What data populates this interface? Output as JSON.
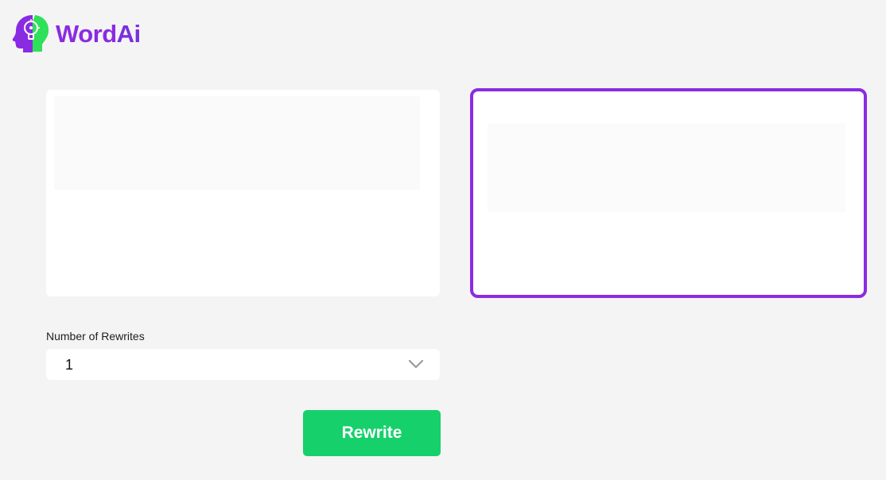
{
  "brand": {
    "name_word": "Word",
    "name_ai": "Ai",
    "logo_icon": "head-lightbulb-icon",
    "purple": "#8a2be2",
    "green": "#16d06b"
  },
  "editor": {
    "input_value": "",
    "output_value": ""
  },
  "rewrites": {
    "label": "Number of Rewrites",
    "selected": "1"
  },
  "actions": {
    "rewrite_label": "Rewrite"
  }
}
